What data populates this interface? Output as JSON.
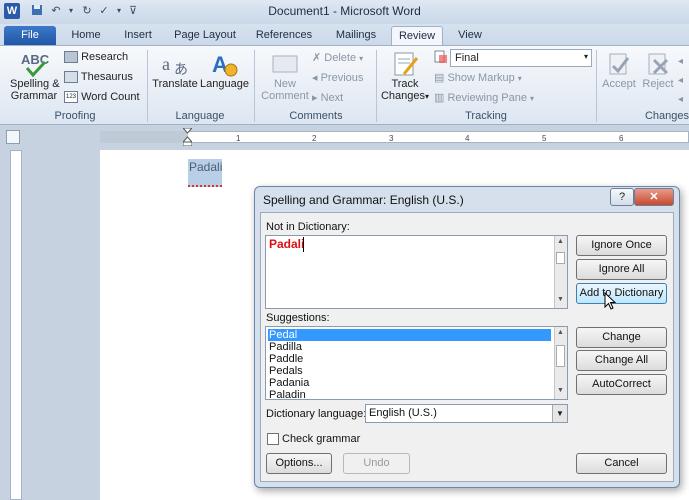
{
  "window": {
    "title": "Document1 - Microsoft Word"
  },
  "tabs": [
    "File",
    "Home",
    "Insert",
    "Page Layout",
    "References",
    "Mailings",
    "Review",
    "View"
  ],
  "active_tab": "Review",
  "ribbon": {
    "proofing": {
      "spelling_line1": "Spelling &",
      "spelling_line2": "Grammar",
      "research": "Research",
      "thesaurus": "Thesaurus",
      "word_count": "Word Count",
      "label": "Proofing"
    },
    "language": {
      "translate": "Translate",
      "language": "Language",
      "label": "Language"
    },
    "comments": {
      "new_line1": "New",
      "new_line2": "Comment",
      "delete": "Delete",
      "previous": "Previous",
      "next": "Next",
      "label": "Comments"
    },
    "tracking": {
      "track_line1": "Track",
      "track_line2": "Changes",
      "final_value": "Final",
      "show_markup": "Show Markup",
      "reviewing_pane": "Reviewing Pane",
      "label": "Tracking"
    },
    "changes": {
      "accept": "Accept",
      "reject": "Reject",
      "label": "Changes"
    }
  },
  "document": {
    "word": "Padali"
  },
  "dialog": {
    "title": "Spelling and Grammar: English (U.S.)",
    "help": "?",
    "close": "✕",
    "not_in_dict_label": "Not in Dictionary:",
    "not_in_dict_value": "Padali",
    "suggestions_label": "Suggestions:",
    "suggestions": [
      "Pedal",
      "Padilla",
      "Paddle",
      "Pedals",
      "Padania",
      "Paladin"
    ],
    "selected_suggestion": "Pedal",
    "dict_lang_label": "Dictionary language:",
    "dict_lang_value": "English (U.S.)",
    "check_grammar": "Check grammar",
    "buttons": {
      "ignore_once": "Ignore Once",
      "ignore_all": "Ignore All",
      "add_to_dictionary": "Add to Dictionary",
      "change": "Change",
      "change_all": "Change All",
      "autocorrect": "AutoCorrect",
      "options": "Options...",
      "undo": "Undo",
      "cancel": "Cancel"
    }
  },
  "colors": {
    "accent": "#2a5aa8",
    "error": "#e01010",
    "selection": "#3399ff"
  }
}
